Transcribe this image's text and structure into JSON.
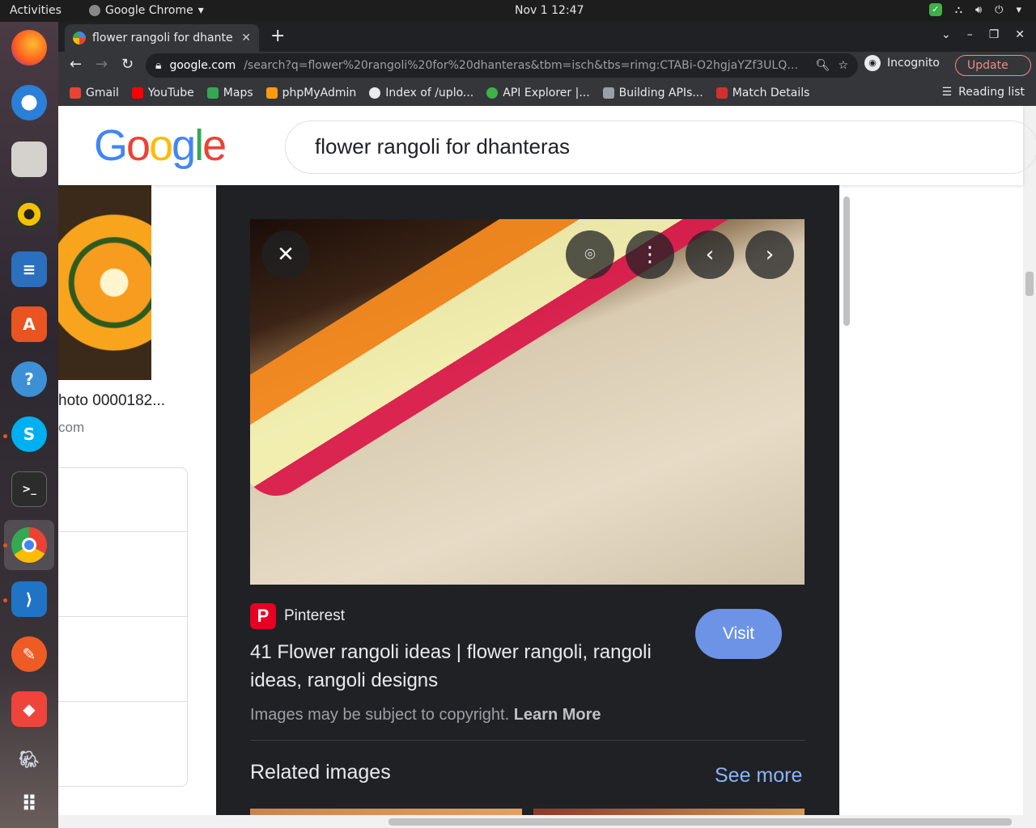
{
  "system": {
    "activities": "Activities",
    "app_name": "Google Chrome",
    "clock": "Nov 1  12:47"
  },
  "dock": {
    "items": [
      "firefox-icon",
      "thunderbird-icon",
      "files-icon",
      "rhythmbox-icon",
      "libreoffice-writer-icon",
      "software-center-icon",
      "help-icon",
      "skype-icon",
      "terminal-icon",
      "chrome-icon",
      "vscode-icon",
      "postman-icon",
      "anydesk-icon",
      "pgadmin-icon",
      "show-apps-icon"
    ]
  },
  "browser": {
    "tab_title": "flower rangoli for dhante",
    "url_domain": "google.com",
    "url_rest": "/search?q=flower%20rangoli%20for%20dhanteras&tbm=isch&tbs=rimg:CTABi-O2hgjaYZf3ULQMkuQqsgIGC...",
    "incognito": "Incognito",
    "update": "Update",
    "reading_list": "Reading list",
    "bookmarks": [
      {
        "label": "Gmail",
        "color": "#ea4335"
      },
      {
        "label": "YouTube",
        "color": "#ff0000"
      },
      {
        "label": "Maps",
        "color": "#34a853"
      },
      {
        "label": "phpMyAdmin",
        "color": "#f89c0e"
      },
      {
        "label": "Index of /uplo...",
        "color": "#e8eaed"
      },
      {
        "label": "API Explorer |...",
        "color": "#3fb04a"
      },
      {
        "label": "Building APIs...",
        "color": "#9aa0a6"
      },
      {
        "label": "Match Details",
        "color": "#d32f2f"
      }
    ]
  },
  "google": {
    "logo": "Google",
    "query": "flower rangoli for dhanteras"
  },
  "left_result": {
    "caption": "hoto 0000182...",
    "source": "com"
  },
  "preview": {
    "source_name": "Pinterest",
    "title": "41 Flower rangoli ideas | flower rangoli, rangoli ideas, rangoli designs",
    "visit": "Visit",
    "copyright": "Images may be subject to copyright.",
    "learn_more": "Learn More",
    "related": "Related images",
    "see_more": "See more"
  }
}
